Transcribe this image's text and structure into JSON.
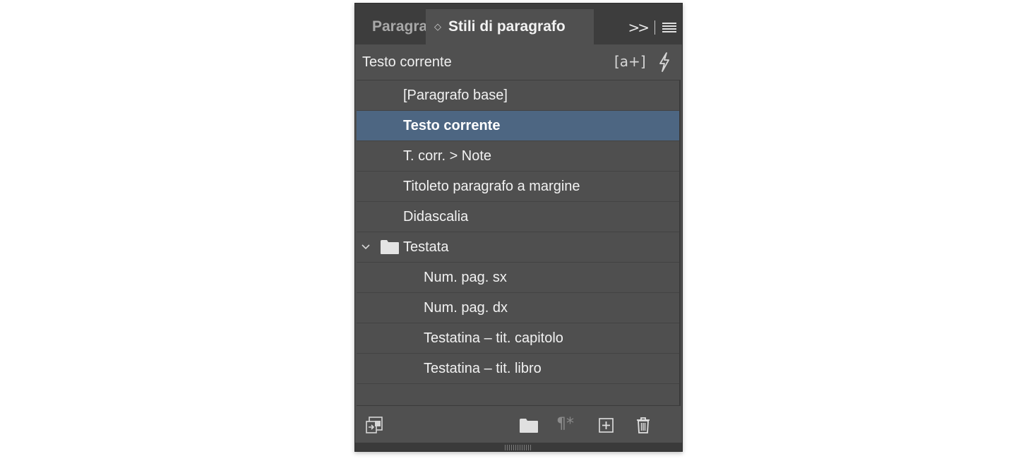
{
  "tabs": {
    "inactive_label": "Paragrafo",
    "active_label": "Stili di paragrafo"
  },
  "header": {
    "current_style": "Testo corrente",
    "new_style_icon": "[a+]"
  },
  "styles": [
    {
      "label": "[Paragrafo base]"
    },
    {
      "label": "Testo corrente",
      "selected": true
    },
    {
      "label": "T. corr. > Note"
    },
    {
      "label": "Titoleto paragrafo a margine"
    },
    {
      "label": "Didascalia"
    },
    {
      "label": "Testata",
      "group": true,
      "expanded": true
    },
    {
      "label": "Num. pag. sx",
      "child": true
    },
    {
      "label": "Num. pag. dx",
      "child": true
    },
    {
      "label": "Testatina – tit. capitolo",
      "child": true
    },
    {
      "label": "Testatina – tit. libro",
      "child": true
    }
  ],
  "footer": {
    "clear_overrides_icon": "¶*"
  },
  "colors": {
    "panel_bg": "#505050",
    "tabbar_bg": "#3d3d3d",
    "selection": "#4d6682",
    "text": "#f2f2f2"
  },
  "icons": [
    "collapse-panel-icon",
    "panel-menu-icon",
    "new-style-icon",
    "lightning-icon",
    "chevron-down-icon",
    "folder-icon",
    "load-styles-icon",
    "new-group-icon",
    "clear-overrides-icon",
    "new-style-button-icon",
    "trash-icon"
  ]
}
